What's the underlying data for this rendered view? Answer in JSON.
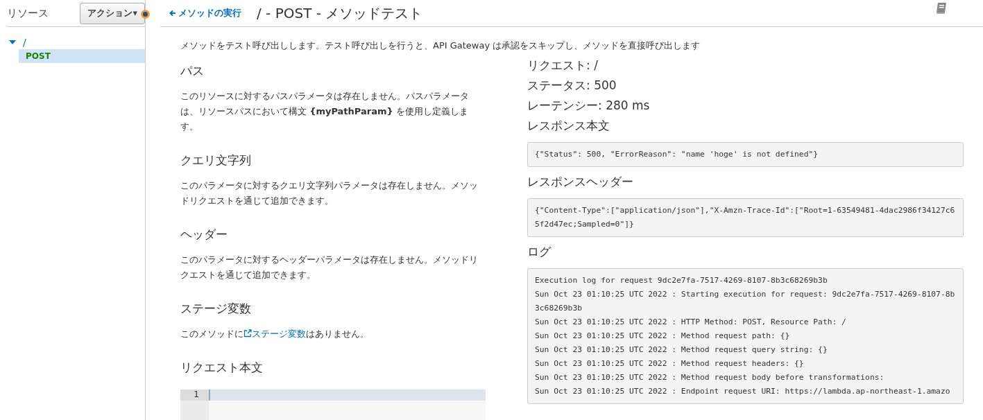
{
  "sidebar": {
    "title": "リソース",
    "action_button": "アクション▾",
    "tree": [
      {
        "label": "/",
        "expanded": true,
        "selected": false,
        "children": [
          {
            "label": "POST",
            "selected": true
          }
        ]
      }
    ]
  },
  "header": {
    "back_link": "メソッドの実行",
    "title": "/ - POST - メソッドテスト"
  },
  "intro": "メソッドをテスト呼び出しします。テスト呼び出しを行うと、API Gateway は承認をスキップし、メソッドを直接呼び出します",
  "left_sections": [
    {
      "heading": "パス",
      "text": "このリソースに対するパスパラメータは存在しません。パスパラメータは、リソースパスにおいて構文 **{myPathParam}** を使用し定義します。"
    },
    {
      "heading": "クエリ文字列",
      "text": "このパラメータに対するクエリ文字列パラメータは存在しません。メソッドリクエストを通じて追加できます。"
    },
    {
      "heading": "ヘッダー",
      "text": "このパラメータに対するヘッダーパラメータは存在しません。メソッドリクエストを通じて追加できます。"
    },
    {
      "heading": "ステージ変数",
      "text_before": "このメソッドに",
      "link": "ステージ変数",
      "text_after": "はありません。"
    }
  ],
  "request_body": {
    "heading": "リクエスト本文",
    "line_numbers": [
      "1"
    ]
  },
  "result": {
    "request": "リクエスト: /",
    "status": "ステータス: 500",
    "latency": "レーテンシー: 280 ms",
    "sections": [
      {
        "heading": "レスポンス本文",
        "lines": [
          "{\"Status\": 500, \"ErrorReason\": \"name 'hoge' is not defined\"}"
        ]
      },
      {
        "heading": "レスポンスヘッダー",
        "lines": [
          "{\"Content-Type\":[\"application/json\"],\"X-Amzn-Trace-Id\":[\"Root=1-63549481-4dac2986f34127c65f2d47ec;Sampled=0\"]}"
        ]
      },
      {
        "heading": "ログ",
        "lines": [
          "Execution log for request 9dc2e7fa-7517-4269-8107-8b3c68269b3b",
          "Sun Oct 23 01:10:25 UTC 2022 : Starting execution for request: 9dc2e7fa-7517-4269-8107-8b3c68269b3b",
          "Sun Oct 23 01:10:25 UTC 2022 : HTTP Method: POST, Resource Path: /",
          "Sun Oct 23 01:10:25 UTC 2022 : Method request path: {}",
          "Sun Oct 23 01:10:25 UTC 2022 : Method request query string: {}",
          "Sun Oct 23 01:10:25 UTC 2022 : Method request headers: {}",
          "Sun Oct 23 01:10:25 UTC 2022 : Method request body before transformations:",
          "Sun Oct 23 01:10:25 UTC 2022 : Endpoint request URI: https://lambda.ap-northeast-1.amazo"
        ]
      }
    ]
  }
}
